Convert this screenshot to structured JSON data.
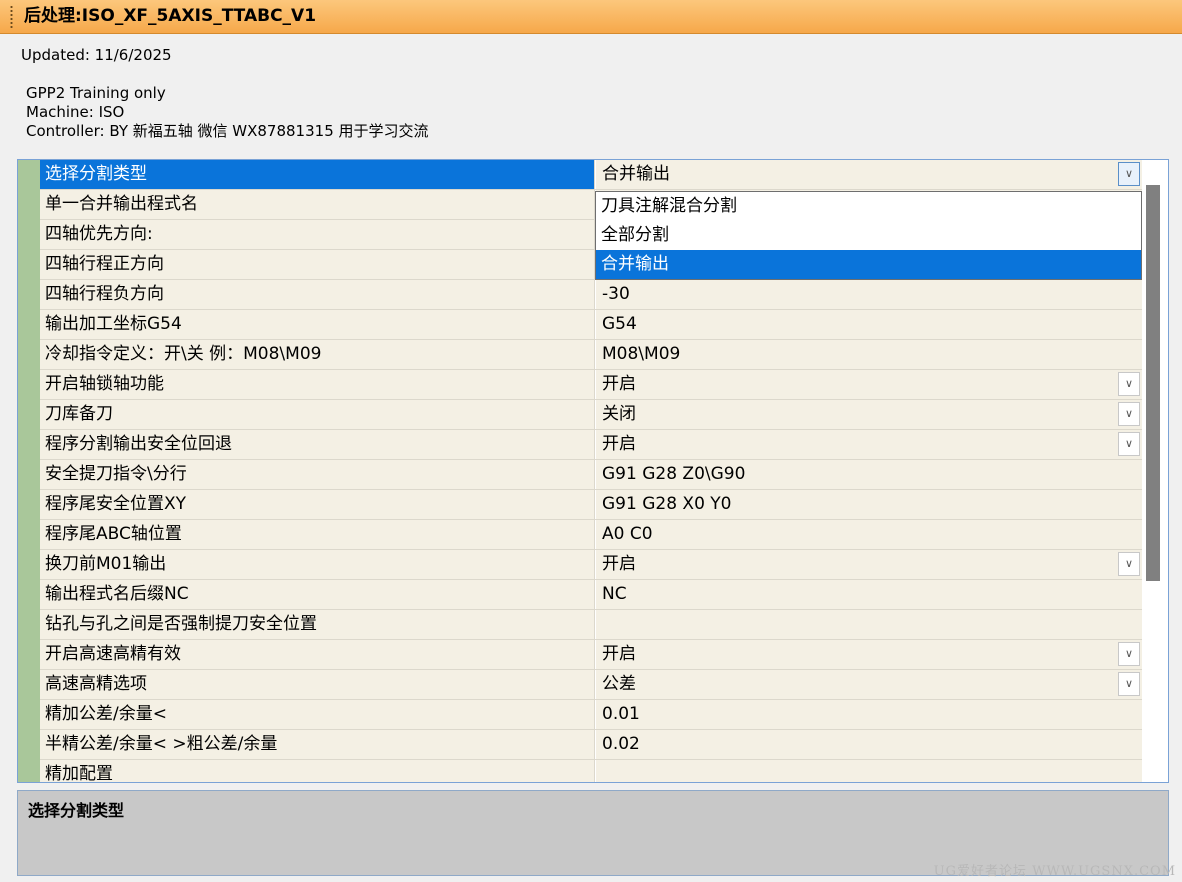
{
  "window": {
    "title": "后处理:ISO_XF_5AXIS_TTABC_V1"
  },
  "info": {
    "updated": "Updated: 11/6/2025",
    "line1": "GPP2 Training only",
    "line2": "Machine: ISO",
    "line3": "Controller: BY 新福五轴 微信 WX87881315 用于学习交流"
  },
  "grid": {
    "rows": [
      {
        "name": "选择分割类型",
        "value": "合并输出",
        "dropdown": true
      },
      {
        "name": "单一合并输出程式名",
        "value": "",
        "dropdown": false
      },
      {
        "name": "四轴优先方向:",
        "value": "",
        "dropdown": false
      },
      {
        "name": "四轴行程正方向",
        "value": "",
        "dropdown": false
      },
      {
        "name": "四轴行程负方向",
        "value": "-30",
        "dropdown": false
      },
      {
        "name": "输出加工坐标G54",
        "value": "G54",
        "dropdown": false
      },
      {
        "name": "冷却指令定义：开\\关 例：M08\\M09",
        "value": "M08\\M09",
        "dropdown": false
      },
      {
        "name": "开启轴锁轴功能",
        "value": "开启",
        "dropdown": true
      },
      {
        "name": "刀库备刀",
        "value": "关闭",
        "dropdown": true
      },
      {
        "name": "程序分割输出安全位回退",
        "value": "开启",
        "dropdown": true
      },
      {
        "name": "安全提刀指令\\分行",
        "value": "G91 G28 Z0\\G90",
        "dropdown": false
      },
      {
        "name": "程序尾安全位置XY",
        "value": "G91 G28 X0 Y0",
        "dropdown": false
      },
      {
        "name": "程序尾ABC轴位置",
        "value": "A0 C0",
        "dropdown": false
      },
      {
        "name": "换刀前M01输出",
        "value": "开启",
        "dropdown": true
      },
      {
        "name": "输出程式名后缀NC",
        "value": "NC",
        "dropdown": false
      },
      {
        "name": "钻孔与孔之间是否强制提刀安全位置",
        "value": "",
        "dropdown": false
      },
      {
        "name": "开启高速高精有效",
        "value": "开启",
        "dropdown": true
      },
      {
        "name": "高速高精选项",
        "value": "公差",
        "dropdown": true
      },
      {
        "name": "精加公差/余量<",
        "value": "0.01",
        "dropdown": false
      },
      {
        "name": "半精公差/余量< >粗公差/余量",
        "value": "0.02",
        "dropdown": false
      },
      {
        "name": "精加配置",
        "value": "",
        "dropdown": false
      }
    ]
  },
  "dropdown_list": {
    "options": [
      "刀具注解混合分割",
      "全部分割",
      "合并输出"
    ],
    "selected_index": 2
  },
  "description": {
    "text": "选择分割类型"
  },
  "watermark": "UG爱好者论坛 WWW.UGSNX.COM",
  "icons": {
    "dropdown_arrow": "chevron-down-icon"
  },
  "colors": {
    "titlebar": "#f6a84a",
    "selection": "#0a74da",
    "gutter": "#a9c79a",
    "cell_bg": "#f4f0e4"
  }
}
